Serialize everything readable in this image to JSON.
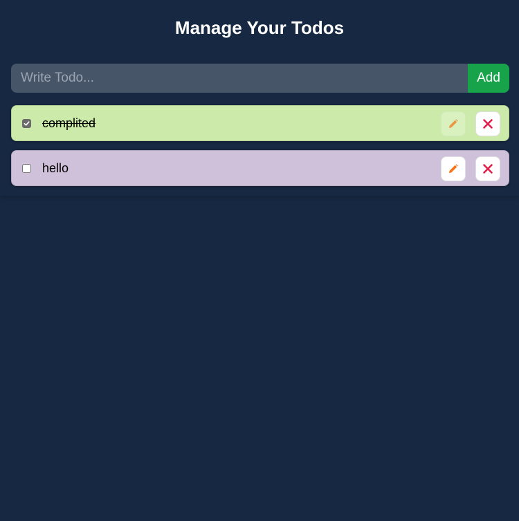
{
  "header": {
    "title": "Manage Your Todos"
  },
  "form": {
    "placeholder": "Write Todo...",
    "value": "",
    "add_label": "Add"
  },
  "todos": [
    {
      "text": "complited",
      "completed": true,
      "bg_color": "#ccebaa",
      "edit_icon": "pencil-icon",
      "delete_icon": "close-icon",
      "edit_disabled": true
    },
    {
      "text": "hello",
      "completed": false,
      "bg_color": "#d0c1da",
      "edit_icon": "pencil-icon",
      "delete_icon": "close-icon",
      "edit_disabled": false
    }
  ],
  "colors": {
    "background": "#172842",
    "input_bg": "#475569",
    "add_button": "#16a34a",
    "pencil": "#f97316",
    "close": "#e11d48"
  }
}
